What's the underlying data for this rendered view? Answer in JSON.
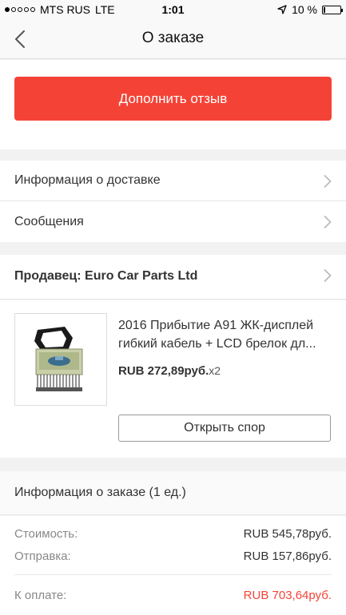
{
  "status_bar": {
    "carrier": "MTS RUS",
    "network": "LTE",
    "time": "1:01",
    "battery_text": "10 %",
    "signal_bars": 1,
    "signal_total": 5,
    "battery_level": 0.1
  },
  "nav": {
    "title": "О заказе",
    "back_icon": "chevron-left-icon"
  },
  "actions": {
    "primary_label": "Дополнить отзыв",
    "primary_color": "#f44336"
  },
  "menu": {
    "items": [
      {
        "label": "Информация о доставке"
      },
      {
        "label": "Сообщения"
      }
    ]
  },
  "seller": {
    "label": "Продавец: Euro Car Parts Ltd"
  },
  "product": {
    "title": "2016 Прибытие А91 ЖК-дисплей гибкий кабель + LCD брелок дл...",
    "price": "RUB 272,89руб.",
    "quantity": "x2",
    "dispute_label": "Открыть спор"
  },
  "order": {
    "header": "Информация о заказе (1 ед.)",
    "cost_label": "Стоимость:",
    "cost_value": "RUB 545,78руб.",
    "shipping_label": "Отправка:",
    "shipping_value": "RUB 157,86руб.",
    "total_label": "К оплате:",
    "total_value": "RUB 703,64руб.",
    "total_color": "#f44336"
  }
}
